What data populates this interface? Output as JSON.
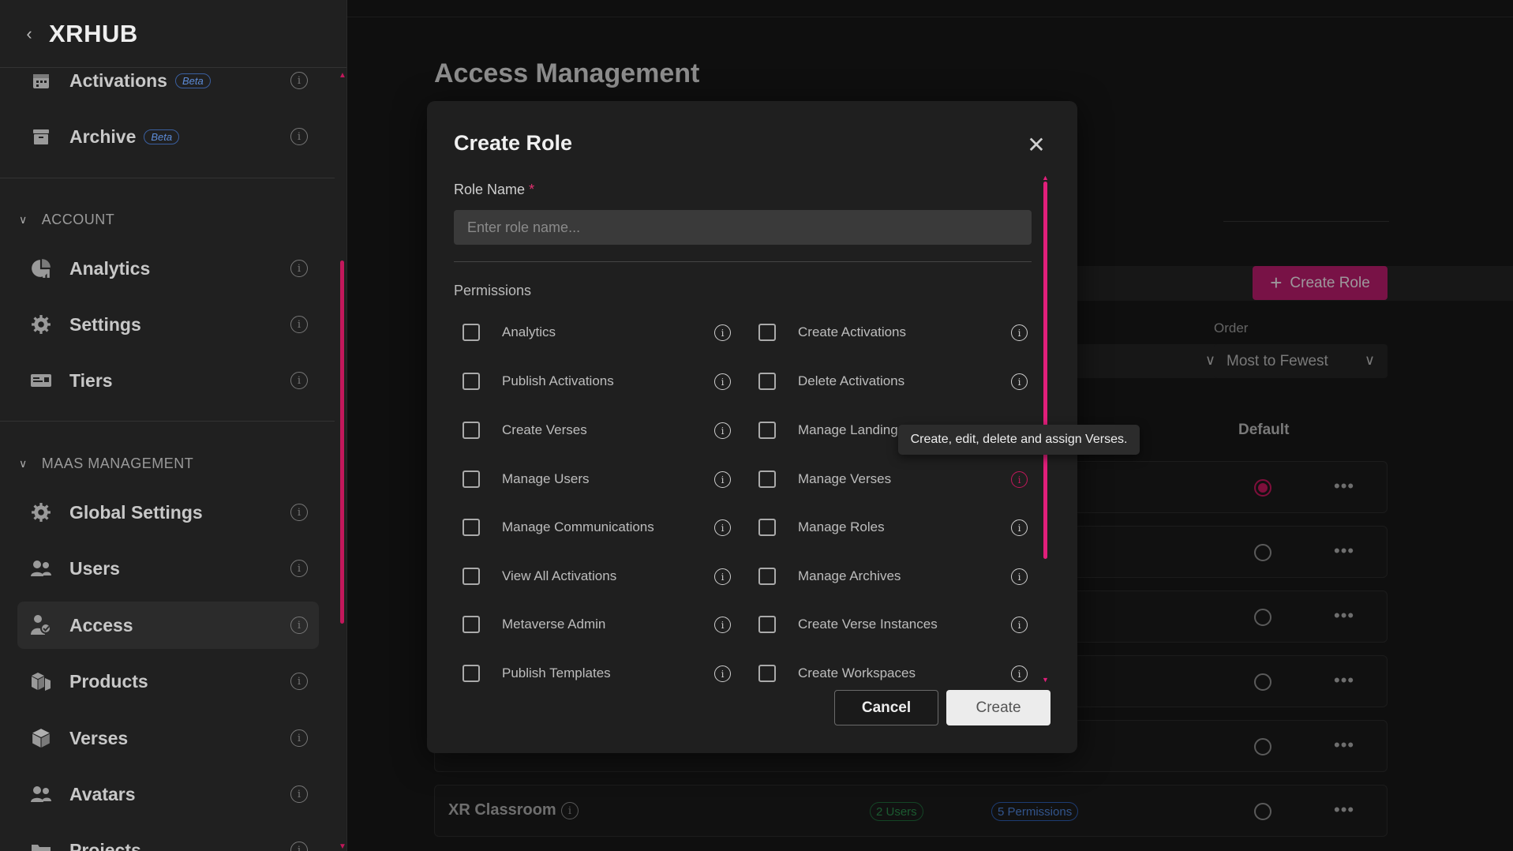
{
  "sidebar": {
    "brand": "XRHUB",
    "items_top": [
      {
        "label": "Activations",
        "badge": "Beta",
        "icon": "calendar-icon"
      },
      {
        "label": "Archive",
        "badge": "Beta",
        "icon": "archive-icon"
      }
    ],
    "account_section": "ACCOUNT",
    "account_items": [
      {
        "label": "Analytics",
        "icon": "chart-icon"
      },
      {
        "label": "Settings",
        "icon": "gear-icon"
      },
      {
        "label": "Tiers",
        "icon": "tiers-icon"
      }
    ],
    "maas_section": "MAAS MANAGEMENT",
    "maas_items": [
      {
        "label": "Global Settings",
        "icon": "gear-icon"
      },
      {
        "label": "Users",
        "icon": "users-icon"
      },
      {
        "label": "Access",
        "icon": "access-icon",
        "active": true
      },
      {
        "label": "Products",
        "icon": "products-icon"
      },
      {
        "label": "Verses",
        "icon": "cube-icon"
      },
      {
        "label": "Avatars",
        "icon": "avatars-icon"
      },
      {
        "label": "Projects",
        "icon": "projects-icon"
      }
    ]
  },
  "main": {
    "title": "Access Management",
    "create_role_button": "Create Role",
    "order_label": "Order",
    "order_value": "Most to Fewest",
    "column_default": "Default",
    "last_row": {
      "name": "XR Classroom",
      "users": "2 Users",
      "permissions": "5 Permissions"
    }
  },
  "modal": {
    "title": "Create Role",
    "role_name_label": "Role Name",
    "required_mark": "*",
    "role_name_placeholder": "Enter role name...",
    "role_name_value": "",
    "permissions_label": "Permissions",
    "permissions_left": [
      "Analytics",
      "Publish Activations",
      "Create Verses",
      "Manage Users",
      "Manage Communications",
      "View All Activations",
      "Metaverse Admin",
      "Publish Templates"
    ],
    "permissions_right": [
      "Create Activations",
      "Delete Activations",
      "Manage Landings",
      "Manage Verses",
      "Manage Roles",
      "Manage Archives",
      "Create Verse Instances",
      "Create Workspaces"
    ],
    "cancel_label": "Cancel",
    "create_label": "Create",
    "tooltip": "Create, edit, delete and assign Verses."
  },
  "colors": {
    "accent": "#c2185b",
    "accent_bright": "#e01f7a",
    "background": "#171717",
    "modal_bg": "#1f1f1f"
  }
}
